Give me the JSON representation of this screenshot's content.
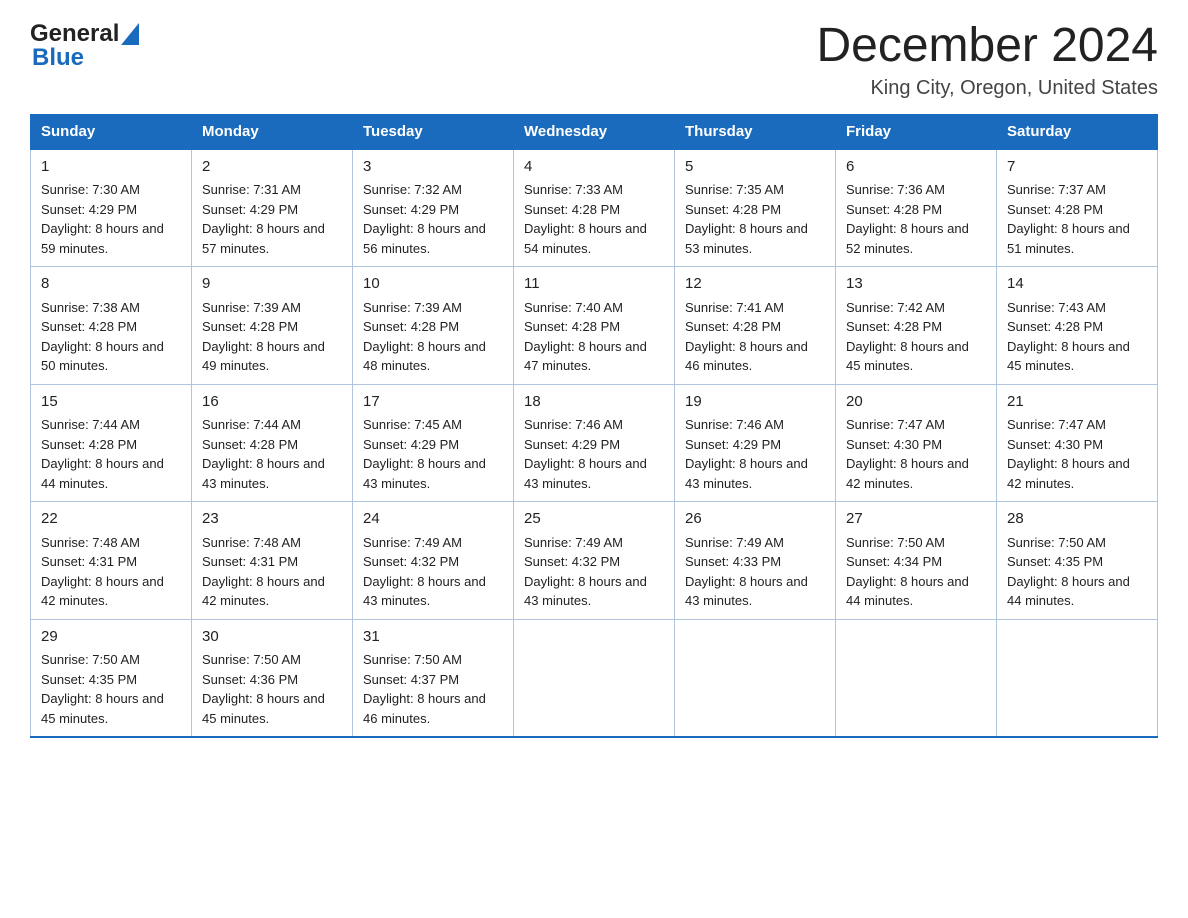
{
  "logo": {
    "general": "General",
    "blue": "Blue"
  },
  "title": "December 2024",
  "subtitle": "King City, Oregon, United States",
  "weekdays": [
    "Sunday",
    "Monday",
    "Tuesday",
    "Wednesday",
    "Thursday",
    "Friday",
    "Saturday"
  ],
  "weeks": [
    [
      {
        "day": "1",
        "sunrise": "7:30 AM",
        "sunset": "4:29 PM",
        "daylight": "8 hours and 59 minutes."
      },
      {
        "day": "2",
        "sunrise": "7:31 AM",
        "sunset": "4:29 PM",
        "daylight": "8 hours and 57 minutes."
      },
      {
        "day": "3",
        "sunrise": "7:32 AM",
        "sunset": "4:29 PM",
        "daylight": "8 hours and 56 minutes."
      },
      {
        "day": "4",
        "sunrise": "7:33 AM",
        "sunset": "4:28 PM",
        "daylight": "8 hours and 54 minutes."
      },
      {
        "day": "5",
        "sunrise": "7:35 AM",
        "sunset": "4:28 PM",
        "daylight": "8 hours and 53 minutes."
      },
      {
        "day": "6",
        "sunrise": "7:36 AM",
        "sunset": "4:28 PM",
        "daylight": "8 hours and 52 minutes."
      },
      {
        "day": "7",
        "sunrise": "7:37 AM",
        "sunset": "4:28 PM",
        "daylight": "8 hours and 51 minutes."
      }
    ],
    [
      {
        "day": "8",
        "sunrise": "7:38 AM",
        "sunset": "4:28 PM",
        "daylight": "8 hours and 50 minutes."
      },
      {
        "day": "9",
        "sunrise": "7:39 AM",
        "sunset": "4:28 PM",
        "daylight": "8 hours and 49 minutes."
      },
      {
        "day": "10",
        "sunrise": "7:39 AM",
        "sunset": "4:28 PM",
        "daylight": "8 hours and 48 minutes."
      },
      {
        "day": "11",
        "sunrise": "7:40 AM",
        "sunset": "4:28 PM",
        "daylight": "8 hours and 47 minutes."
      },
      {
        "day": "12",
        "sunrise": "7:41 AM",
        "sunset": "4:28 PM",
        "daylight": "8 hours and 46 minutes."
      },
      {
        "day": "13",
        "sunrise": "7:42 AM",
        "sunset": "4:28 PM",
        "daylight": "8 hours and 45 minutes."
      },
      {
        "day": "14",
        "sunrise": "7:43 AM",
        "sunset": "4:28 PM",
        "daylight": "8 hours and 45 minutes."
      }
    ],
    [
      {
        "day": "15",
        "sunrise": "7:44 AM",
        "sunset": "4:28 PM",
        "daylight": "8 hours and 44 minutes."
      },
      {
        "day": "16",
        "sunrise": "7:44 AM",
        "sunset": "4:28 PM",
        "daylight": "8 hours and 43 minutes."
      },
      {
        "day": "17",
        "sunrise": "7:45 AM",
        "sunset": "4:29 PM",
        "daylight": "8 hours and 43 minutes."
      },
      {
        "day": "18",
        "sunrise": "7:46 AM",
        "sunset": "4:29 PM",
        "daylight": "8 hours and 43 minutes."
      },
      {
        "day": "19",
        "sunrise": "7:46 AM",
        "sunset": "4:29 PM",
        "daylight": "8 hours and 43 minutes."
      },
      {
        "day": "20",
        "sunrise": "7:47 AM",
        "sunset": "4:30 PM",
        "daylight": "8 hours and 42 minutes."
      },
      {
        "day": "21",
        "sunrise": "7:47 AM",
        "sunset": "4:30 PM",
        "daylight": "8 hours and 42 minutes."
      }
    ],
    [
      {
        "day": "22",
        "sunrise": "7:48 AM",
        "sunset": "4:31 PM",
        "daylight": "8 hours and 42 minutes."
      },
      {
        "day": "23",
        "sunrise": "7:48 AM",
        "sunset": "4:31 PM",
        "daylight": "8 hours and 42 minutes."
      },
      {
        "day": "24",
        "sunrise": "7:49 AM",
        "sunset": "4:32 PM",
        "daylight": "8 hours and 43 minutes."
      },
      {
        "day": "25",
        "sunrise": "7:49 AM",
        "sunset": "4:32 PM",
        "daylight": "8 hours and 43 minutes."
      },
      {
        "day": "26",
        "sunrise": "7:49 AM",
        "sunset": "4:33 PM",
        "daylight": "8 hours and 43 minutes."
      },
      {
        "day": "27",
        "sunrise": "7:50 AM",
        "sunset": "4:34 PM",
        "daylight": "8 hours and 44 minutes."
      },
      {
        "day": "28",
        "sunrise": "7:50 AM",
        "sunset": "4:35 PM",
        "daylight": "8 hours and 44 minutes."
      }
    ],
    [
      {
        "day": "29",
        "sunrise": "7:50 AM",
        "sunset": "4:35 PM",
        "daylight": "8 hours and 45 minutes."
      },
      {
        "day": "30",
        "sunrise": "7:50 AM",
        "sunset": "4:36 PM",
        "daylight": "8 hours and 45 minutes."
      },
      {
        "day": "31",
        "sunrise": "7:50 AM",
        "sunset": "4:37 PM",
        "daylight": "8 hours and 46 minutes."
      },
      null,
      null,
      null,
      null
    ]
  ]
}
